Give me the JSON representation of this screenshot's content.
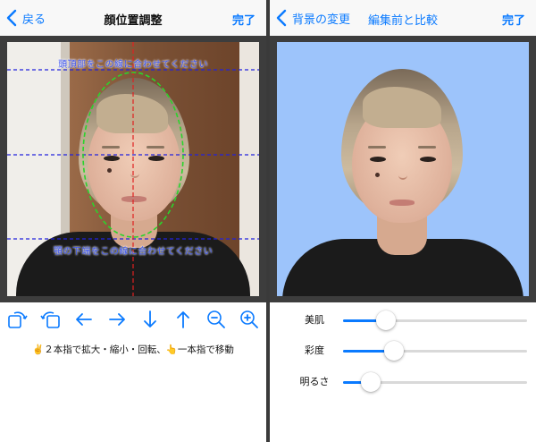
{
  "left": {
    "nav": {
      "back_label": "戻る",
      "title": "顔位置調整",
      "done_label": "完了"
    },
    "guides": {
      "top_text": "頭頂部をこの線に合わせてください",
      "bottom_text": "顎の下端をこの線に合わせてください",
      "colors": {
        "horizontal": "#2222dd",
        "vertical": "#e02020",
        "oval": "#2bd42b",
        "text": "#3a52f0"
      }
    },
    "toolbar": [
      {
        "name": "rotate-left-icon"
      },
      {
        "name": "rotate-right-icon"
      },
      {
        "name": "arrow-left-icon"
      },
      {
        "name": "arrow-right-icon"
      },
      {
        "name": "arrow-down-icon"
      },
      {
        "name": "arrow-up-icon"
      },
      {
        "name": "zoom-out-icon"
      },
      {
        "name": "zoom-in-icon"
      }
    ],
    "hint": "✌️２本指で拡大・縮小・回転、👆一本指で移動"
  },
  "right": {
    "nav": {
      "back_label": "背景の変更",
      "title": "編集前と比較",
      "done_label": "完了"
    },
    "background_color": "#9dc4fb",
    "sliders": [
      {
        "label": "美肌",
        "value": 0.2
      },
      {
        "label": "彩度",
        "value": 0.25
      },
      {
        "label": "明るさ",
        "value": 0.11
      }
    ]
  },
  "colors": {
    "accent": "#0a7aff",
    "panel_bg": "#3d3d3d"
  }
}
